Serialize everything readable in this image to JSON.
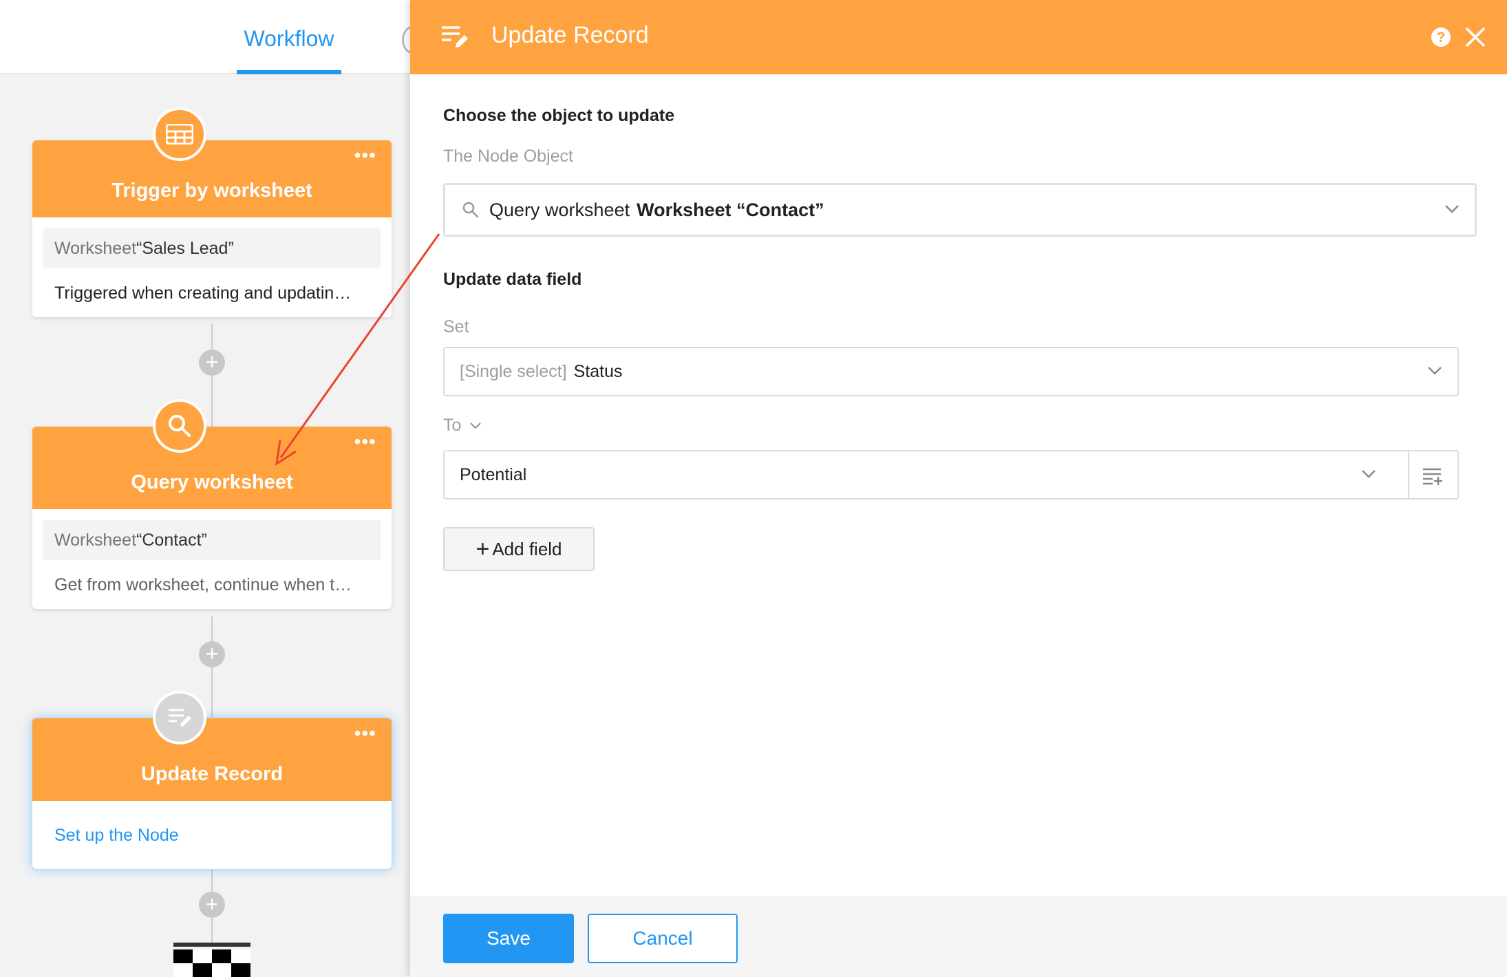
{
  "colors": {
    "accent_orange": "#ffa340",
    "primary_blue": "#2196f3",
    "annotation_red": "#e8452c"
  },
  "header": {
    "tab_label": "Workflow"
  },
  "nodes": {
    "trigger": {
      "title": "Trigger by worksheet",
      "icon": "worksheet-grid-icon",
      "ws_prefix": "Worksheet",
      "ws_name": "“Sales Lead”",
      "description": "Triggered when creating and updatin…"
    },
    "query": {
      "title": "Query worksheet",
      "icon": "search-icon",
      "ws_prefix": "Worksheet",
      "ws_name": "“Contact”",
      "description": "Get from worksheet, continue when t…"
    },
    "update": {
      "title": "Update Record",
      "icon": "edit-record-icon",
      "link": "Set up the Node"
    },
    "more_label": "•••"
  },
  "panel": {
    "title": "Update Record",
    "help_label": "?",
    "section_object": "Choose the object to update",
    "node_object_label": "The Node Object",
    "object_select": {
      "prefix": "Query worksheet",
      "value": "Worksheet “Contact”"
    },
    "section_update": "Update data field",
    "set_label": "Set",
    "set_select": {
      "type": "[Single select]",
      "field": "Status"
    },
    "to_label": "To",
    "to_select": {
      "value": "Potential"
    },
    "add_field_label": "Add field",
    "save_label": "Save",
    "cancel_label": "Cancel"
  }
}
